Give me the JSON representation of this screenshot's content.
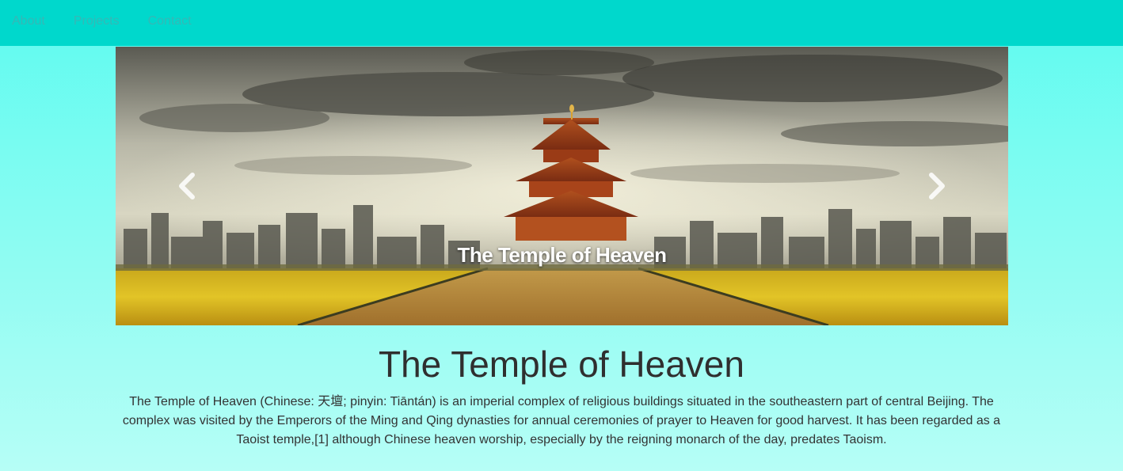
{
  "nav": {
    "items": [
      {
        "label": "About"
      },
      {
        "label": "Projects"
      },
      {
        "label": "Contact"
      }
    ]
  },
  "carousel": {
    "caption": "The Temple of Heaven",
    "prev_icon": "chevron-left-icon",
    "next_icon": "chevron-right-icon"
  },
  "content": {
    "title": "The Temple of Heaven",
    "description": "The Temple of Heaven (Chinese: 天壇; pinyin: Tiāntán) is an imperial complex of religious buildings situated in the southeastern part of central Beijing. The complex was visited by the Emperors of the Ming and Qing dynasties for annual ceremonies of prayer to Heaven for good harvest. It has been regarded as a Taoist temple,[1] although Chinese heaven worship, especially by the reigning monarch of the day, predates Taoism."
  },
  "colors": {
    "navbar": "#00d8cc",
    "nav_link": "#35b8b6",
    "page_top": "#5cfbf0",
    "page_bottom": "#b6fef6",
    "title_text": "#2f2f2f"
  }
}
